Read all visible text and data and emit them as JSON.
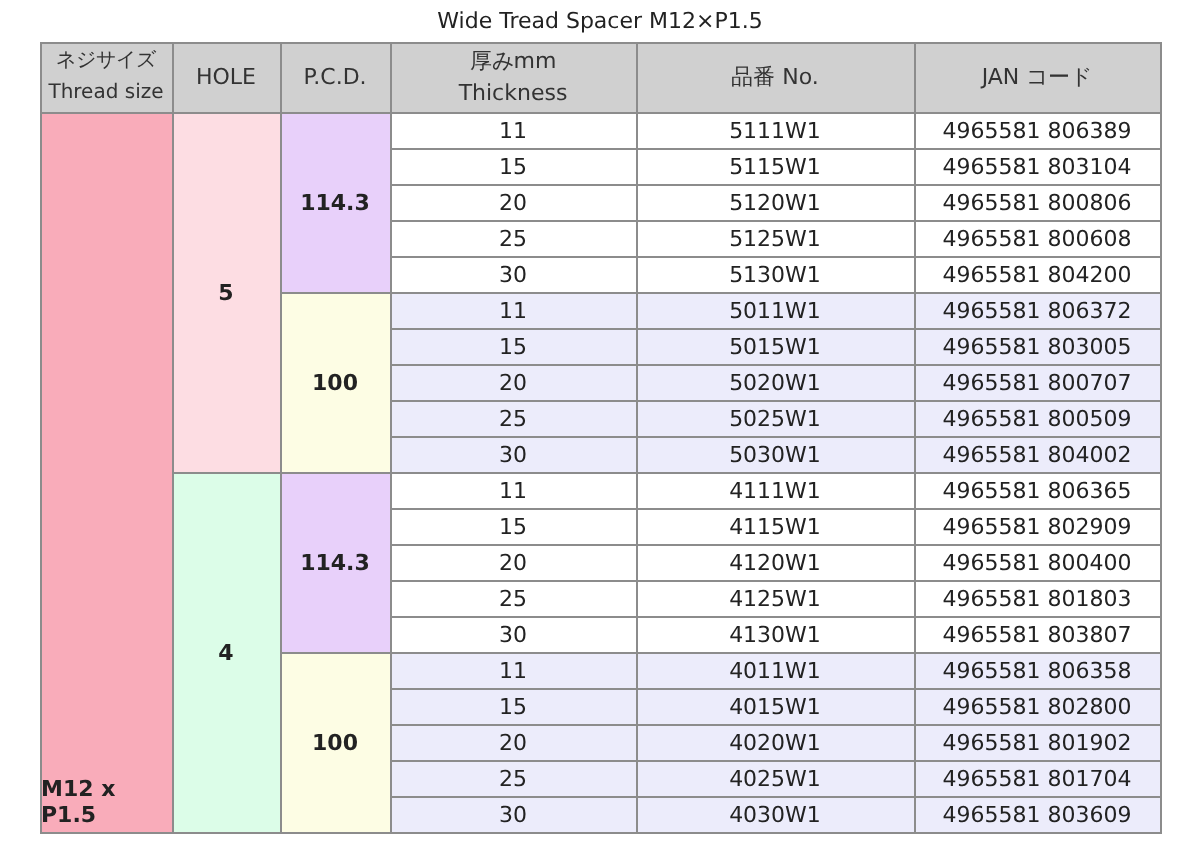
{
  "title": "Wide Tread Spacer M12×P1.5",
  "columns": [
    {
      "lines": [
        "ネジサイズ",
        "Thread size"
      ]
    },
    {
      "lines": [
        "HOLE"
      ]
    },
    {
      "lines": [
        "P.C.D."
      ]
    },
    {
      "lines": [
        "厚みmm",
        "Thickness"
      ]
    },
    {
      "lines": [
        "品番 No."
      ]
    },
    {
      "lines": [
        "JAN コード"
      ]
    }
  ],
  "groups": [
    {
      "thread_size": "M12 x P1.5",
      "color": "#f9acba",
      "children": [
        {
          "hole": "5",
          "color": "#fddde3",
          "children": [
            {
              "pcd": "114.3",
              "color": "#e8d0fa",
              "rows": [
                {
                  "thickness": "11",
                  "part_no": "5111W1",
                  "jan": "4965581 806389"
                },
                {
                  "thickness": "15",
                  "part_no": "5115W1",
                  "jan": "4965581 803104"
                },
                {
                  "thickness": "20",
                  "part_no": "5120W1",
                  "jan": "4965581 800806"
                },
                {
                  "thickness": "25",
                  "part_no": "5125W1",
                  "jan": "4965581 800608"
                },
                {
                  "thickness": "30",
                  "part_no": "5130W1",
                  "jan": "4965581 804200"
                }
              ]
            },
            {
              "pcd": "100",
              "color": "#fdfde4",
              "rows": [
                {
                  "thickness": "11",
                  "part_no": "5011W1",
                  "jan": "4965581 806372"
                },
                {
                  "thickness": "15",
                  "part_no": "5015W1",
                  "jan": "4965581 803005"
                },
                {
                  "thickness": "20",
                  "part_no": "5020W1",
                  "jan": "4965581 800707"
                },
                {
                  "thickness": "25",
                  "part_no": "5025W1",
                  "jan": "4965581 800509"
                },
                {
                  "thickness": "30",
                  "part_no": "5030W1",
                  "jan": "4965581 804002"
                }
              ]
            }
          ]
        },
        {
          "hole": "4",
          "color": "#dcfde8",
          "children": [
            {
              "pcd": "114.3",
              "color": "#e8d0fa",
              "rows": [
                {
                  "thickness": "11",
                  "part_no": "4111W1",
                  "jan": "4965581 806365"
                },
                {
                  "thickness": "15",
                  "part_no": "4115W1",
                  "jan": "4965581 802909"
                },
                {
                  "thickness": "20",
                  "part_no": "4120W1",
                  "jan": "4965581 800400"
                },
                {
                  "thickness": "25",
                  "part_no": "4125W1",
                  "jan": "4965581 801803"
                },
                {
                  "thickness": "30",
                  "part_no": "4130W1",
                  "jan": "4965581 803807"
                }
              ]
            },
            {
              "pcd": "100",
              "color": "#fdfde4",
              "rows": [
                {
                  "thickness": "11",
                  "part_no": "4011W1",
                  "jan": "4965581 806358"
                },
                {
                  "thickness": "15",
                  "part_no": "4015W1",
                  "jan": "4965581 802800"
                },
                {
                  "thickness": "20",
                  "part_no": "4020W1",
                  "jan": "4965581 801902"
                },
                {
                  "thickness": "25",
                  "part_no": "4025W1",
                  "jan": "4965581 801704"
                },
                {
                  "thickness": "30",
                  "part_no": "4030W1",
                  "jan": "4965581 803609"
                }
              ]
            }
          ]
        }
      ]
    }
  ]
}
